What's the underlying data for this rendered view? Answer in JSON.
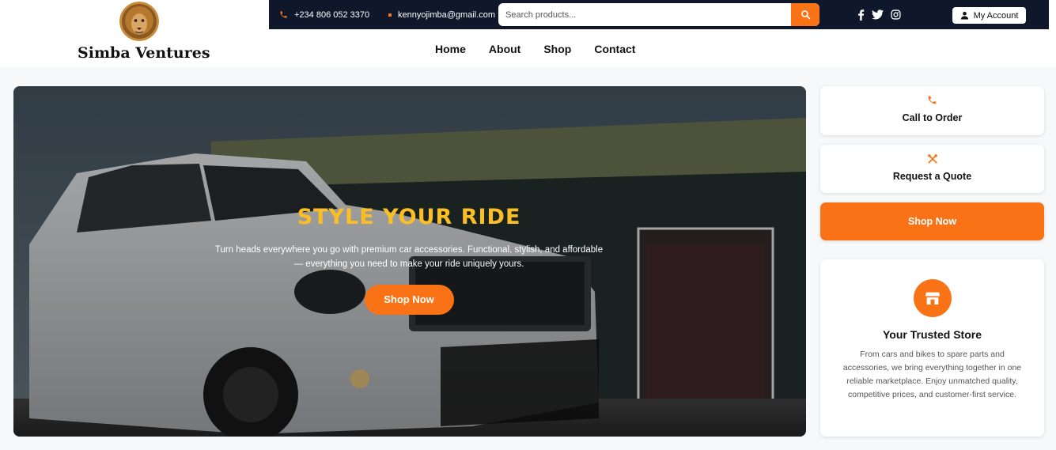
{
  "brand": {
    "name": "Simba Ventures",
    "logo": "lion-logo"
  },
  "topbar": {
    "phone": "+234 806 052 3370",
    "email": "kennyojimba@gmail.com",
    "search_placeholder": "Search products...",
    "account_label": "My Account",
    "social": [
      "facebook-icon",
      "twitter-icon",
      "instagram-icon"
    ]
  },
  "nav": {
    "items": [
      "Home",
      "About",
      "Shop",
      "Contact"
    ]
  },
  "hero": {
    "title": "STYLE YOUR RIDE",
    "text": "Turn heads everywhere you go with premium car accessories. Functional, stylish, and affordable — everything you need to make your ride uniquely yours.",
    "button": "Shop Now"
  },
  "sidebar": {
    "call": "Call to Order",
    "quote": "Request a Quote",
    "shop": "Shop Now",
    "store_title": "Your Trusted Store",
    "store_text": "From cars and bikes to spare parts and accessories, we bring everything together in one reliable marketplace. Enjoy unmatched quality, competitive prices, and customer-first service."
  },
  "colors": {
    "accent": "#f97316",
    "topbar": "#0f172a",
    "hero_title": "#fbbf24"
  }
}
